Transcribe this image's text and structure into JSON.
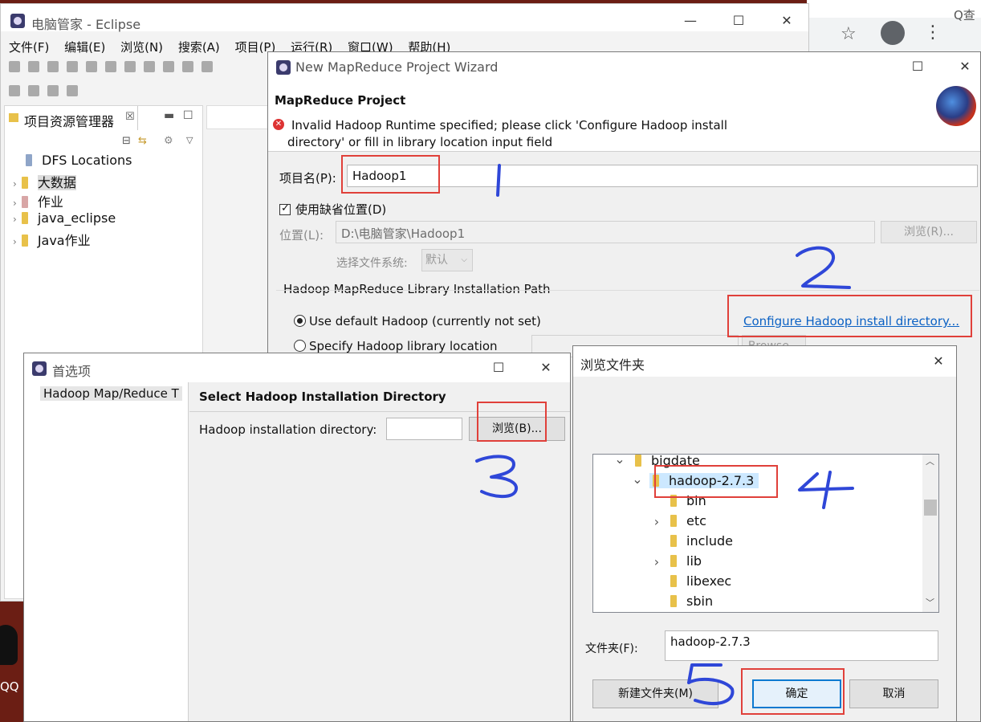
{
  "eclipse": {
    "title": "电脑管家 - Eclipse",
    "menu": [
      "文件(F)",
      "编辑(E)",
      "浏览(N)",
      "搜索(A)",
      "项目(P)",
      "运行(R)",
      "窗口(W)",
      "帮助(H)"
    ],
    "explorer_title": "项目资源管理器",
    "explorer_close": "☒",
    "tree": [
      "DFS Locations",
      "大数据",
      "作业",
      "java_eclipse",
      "Java作业"
    ]
  },
  "desktop": {
    "qq_label": "QQ"
  },
  "browser": {
    "search_hint": "Q查"
  },
  "wizard": {
    "title": "New MapReduce Project Wizard",
    "heading": "MapReduce Project",
    "error_line1": "Invalid Hadoop Runtime specified; please click 'Configure Hadoop install",
    "error_line2": "directory' or fill in library location input field",
    "project_name_label": "项目名(P):",
    "project_name_value": "Hadoop1",
    "use_default_label": "使用缺省位置(D)",
    "location_label": "位置(L):",
    "location_value": "D:\\电脑管家\\Hadoop1",
    "browse_label": "浏览(R)...",
    "filesystem_label": "选择文件系统:",
    "filesystem_value": "默认",
    "group_title": "Hadoop MapReduce Library Installation Path",
    "use_default_hadoop": "Use default Hadoop (currently not set)",
    "configure_link": "Configure Hadoop install directory...",
    "specify_library": "Specify Hadoop library location",
    "browse2_label": "Browse..."
  },
  "prefs": {
    "title": "首选项",
    "sidebar_item": "Hadoop Map/Reduce T",
    "heading": "Select Hadoop Installation Directory",
    "dir_label": "Hadoop installation directory:",
    "dir_value": "",
    "browse_label": "浏览(B)..."
  },
  "folder_dialog": {
    "title": "浏览文件夹",
    "tree": [
      {
        "name": "bigdate",
        "expander": "v"
      },
      {
        "name": "hadoop-2.7.3",
        "expander": "v"
      },
      {
        "name": "bin",
        "expander": ""
      },
      {
        "name": "etc",
        "expander": ">"
      },
      {
        "name": "include",
        "expander": ""
      },
      {
        "name": "lib",
        "expander": ">"
      },
      {
        "name": "libexec",
        "expander": ""
      },
      {
        "name": "sbin",
        "expander": ""
      }
    ],
    "folder_label": "文件夹(F):",
    "folder_value": "hadoop-2.7.3",
    "new_folder_label": "新建文件夹(M)",
    "ok_label": "确定",
    "cancel_label": "取消"
  },
  "annotations": {
    "step1": "1",
    "step2": "2",
    "step3": "3",
    "step4": "4",
    "step5": "5"
  }
}
